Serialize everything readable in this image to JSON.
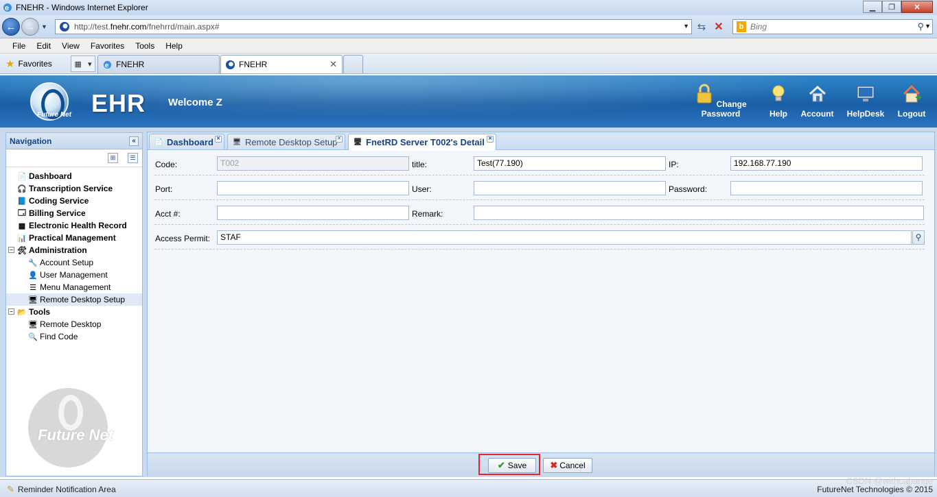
{
  "browser": {
    "window_title": "FNEHR - Windows Internet Explorer",
    "url_prefix": "http://test.",
    "url_domain": "fnehr.com",
    "url_path": "/fnehrrd/main.aspx#",
    "search_placeholder": "Bing",
    "menu": [
      "File",
      "Edit",
      "View",
      "Favorites",
      "Tools",
      "Help"
    ],
    "favorites_label": "Favorites",
    "tabs": [
      {
        "label": "FNEHR"
      },
      {
        "label": "FNEHR"
      }
    ]
  },
  "header": {
    "logo_text": "Future Net",
    "app_title": "EHR",
    "welcome": "Welcome Z",
    "buttons": [
      {
        "label": "Change Password",
        "icon": "lock-icon"
      },
      {
        "label": "Help",
        "icon": "lightbulb-icon"
      },
      {
        "label": "Account",
        "icon": "house-icon"
      },
      {
        "label": "HelpDesk",
        "icon": "monitor-icon"
      },
      {
        "label": "Logout",
        "icon": "logout-house-icon"
      }
    ]
  },
  "navigation": {
    "title": "Navigation",
    "items": [
      {
        "label": "Dashboard",
        "level": 1
      },
      {
        "label": "Transcription Service",
        "level": 1
      },
      {
        "label": "Coding Service",
        "level": 1
      },
      {
        "label": "Billing Service",
        "level": 1
      },
      {
        "label": "Electronic Health Record",
        "level": 1
      },
      {
        "label": "Practical Management",
        "level": 1
      },
      {
        "label": "Administration",
        "level": 1,
        "expanded": true
      },
      {
        "label": "Account Setup",
        "level": 2
      },
      {
        "label": "User Management",
        "level": 2
      },
      {
        "label": "Menu Management",
        "level": 2
      },
      {
        "label": "Remote Desktop Setup",
        "level": 2,
        "selected": true
      },
      {
        "label": "Tools",
        "level": 1,
        "expanded": true
      },
      {
        "label": "Remote Desktop",
        "level": 2
      },
      {
        "label": "Find Code",
        "level": 2
      }
    ],
    "watermark_text": "Future Net"
  },
  "tabs": [
    {
      "label": "Dashboard"
    },
    {
      "label": "Remote Desktop Setup"
    },
    {
      "label": "FnetRD Server T002's Detail",
      "active": true
    }
  ],
  "form": {
    "code_label": "Code:",
    "code_value": "T002",
    "title_label": "title:",
    "title_value": "Test(77.190)",
    "ip_label": "IP:",
    "ip_value": "192.168.77.190",
    "port_label": "Port:",
    "port_value": "",
    "user_label": "User:",
    "user_value": "",
    "password_label": "Password:",
    "password_value": "",
    "acct_label": "Acct #:",
    "acct_value": "",
    "remark_label": "Remark:",
    "remark_value": "",
    "permit_label": "Access Permit:",
    "permit_value": "STAF"
  },
  "actions": {
    "save_label": "Save",
    "cancel_label": "Cancel"
  },
  "status": {
    "reminder": "Reminder Notification Area",
    "copyright": "FutureNet Technologies © 2015",
    "overlay": "CSDN @withcabange"
  }
}
